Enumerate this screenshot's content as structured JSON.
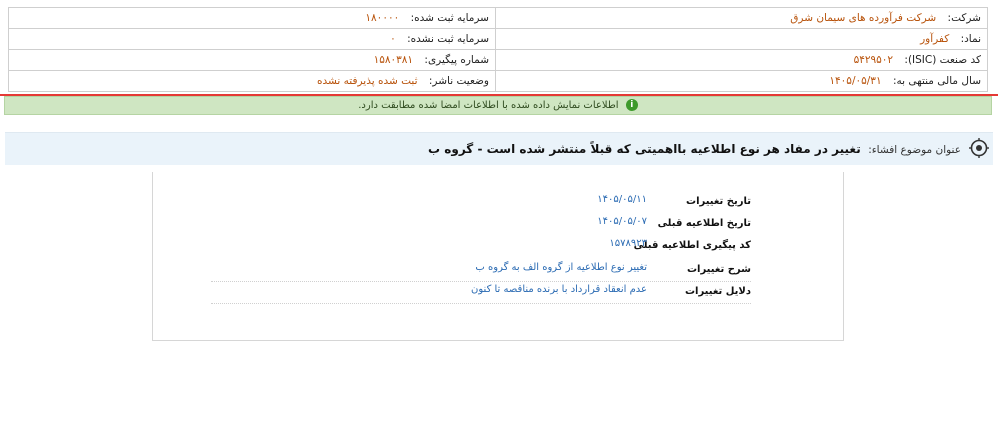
{
  "company_info": {
    "company_label": "شرکت:",
    "company_value": "شرکت فرآورده های سیمان شرق",
    "capital_registered_label": "سرمایه ثبت شده:",
    "capital_registered_value": "۱۸۰۰۰۰",
    "symbol_label": "نماد:",
    "symbol_value": "کفرآور",
    "capital_unregistered_label": "سرمایه ثبت نشده:",
    "capital_unregistered_value": "۰",
    "isic_label": "کد صنعت (ISIC):",
    "isic_value": "۵۴۲۹۵۰۲",
    "tracking_label": "شماره پیگیری:",
    "tracking_value": "۱۵۸۰۳۸۱",
    "fiscal_year_label": "سال مالی منتهی به:",
    "fiscal_year_value": "۱۴۰۵/۰۵/۳۱",
    "publisher_status_label": "وضعیت ناشر:",
    "publisher_status_value": "ثبت شده پذیرفته نشده"
  },
  "notice": {
    "text": "اطلاعات نمایش داده شده با اطلاعات امضا شده مطابقت دارد.",
    "icon": "info-icon",
    "color": "#3d9a2b"
  },
  "subject": {
    "label": "عنوان موضوع افشاء:",
    "title": "تغییر در مفاد هر نوع اطلاعیه بااهمیتی که قبلاً منتشر شده است - گروه ب",
    "icon": "target-icon"
  },
  "details": [
    {
      "label": "تاریخ تغییرات",
      "value": "۱۴۰۵/۰۵/۱۱"
    },
    {
      "label": "تاریخ اطلاعیه قبلی",
      "value": "۱۴۰۵/۰۵/۰۷"
    },
    {
      "label": "کد پیگیری اطلاعیه قبلی",
      "value": "۱۵۷۸۹۲۳"
    },
    {
      "label": "شرح تغییرات",
      "value": "تغییر نوع اطلاعیه از گروه الف به گروه ب"
    },
    {
      "label": "دلایل تغییرات",
      "value": "عدم انعقاد قرارداد با برنده مناقصه تا کنون"
    }
  ]
}
